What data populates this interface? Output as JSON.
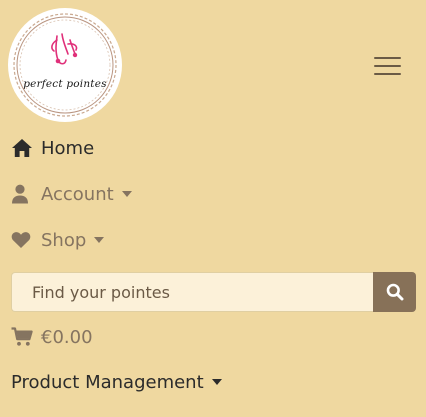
{
  "brand": {
    "logo_text": "perfect pointes"
  },
  "nav": {
    "home_label": "Home",
    "account_label": "Account",
    "shop_label": "Shop",
    "product_management_label": "Product Management"
  },
  "search": {
    "placeholder": "Find your pointes"
  },
  "bag": {
    "total": "€0.00"
  },
  "icons": {
    "home": "home-icon",
    "account": "user-icon",
    "shop": "heart-icon",
    "search": "search-icon",
    "bag": "shopping-cart-icon",
    "menu": "hamburger-menu-icon"
  },
  "colors": {
    "background": "#efd8a0",
    "search_button": "#877158",
    "search_field": "#fcf1d9",
    "muted_text": "#857460",
    "dark_text": "#2b2b2b",
    "logo_accent": "#e0307a"
  }
}
